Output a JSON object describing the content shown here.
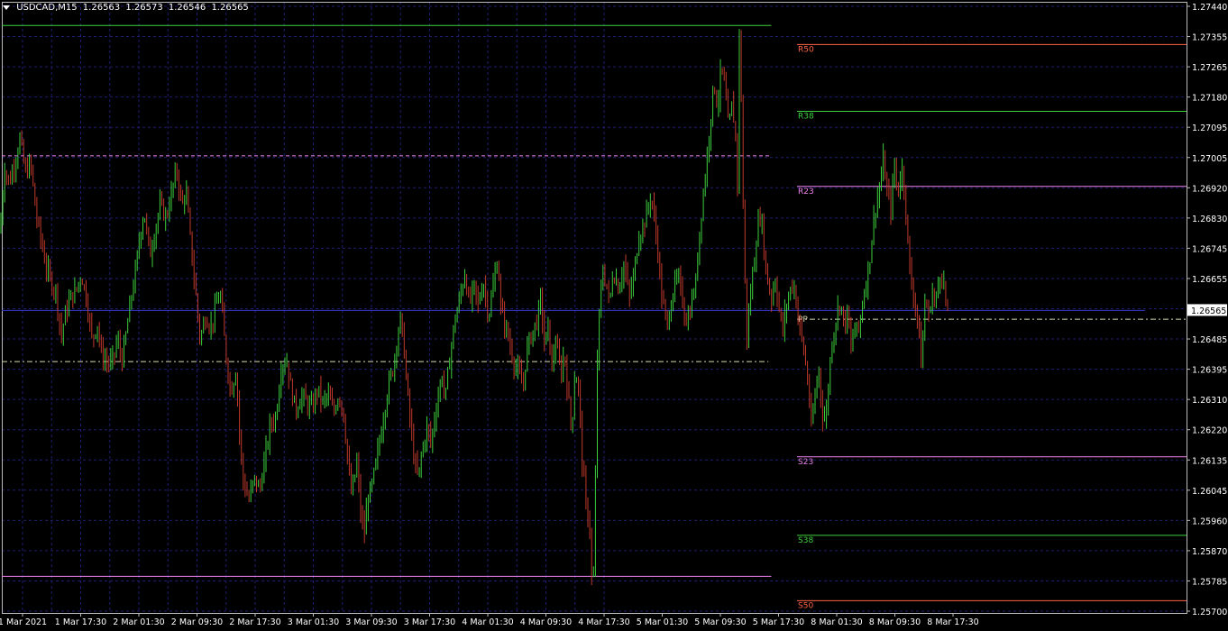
{
  "header": {
    "symbol": "USDCAD,M15",
    "open": "1.26563",
    "high": "1.26573",
    "low": "1.26546",
    "close": "1.26565"
  },
  "colors": {
    "background": "#000000",
    "grid": "#1e1e6e",
    "bull": "#3ccf3c",
    "bear": "#c0392b",
    "axis_text": "#ffffff",
    "pivot": "#d8d8b0",
    "r50": "#ff6347",
    "r38": "#3ccf3c",
    "r23": "#ee82ee",
    "current_price_line": "#3a3ad0",
    "top_line": "#3ccf3c",
    "bottom_line": "#ee82ee",
    "dashed_level": "#ee82ee"
  },
  "chart_data": {
    "type": "candlestick",
    "symbol": "USDCAD",
    "timeframe": "M15",
    "y_ticks": [
      "1.27440",
      "1.27355",
      "1.27265",
      "1.27180",
      "1.27095",
      "1.27005",
      "1.26920",
      "1.26830",
      "1.26745",
      "1.26655",
      "1.26565",
      "1.26485",
      "1.26395",
      "1.26310",
      "1.26220",
      "1.26135",
      "1.26045",
      "1.25960",
      "1.25870",
      "1.25785",
      "1.25700"
    ],
    "ylim": [
      1.257,
      1.2744
    ],
    "current_price": "1.26565",
    "x_ticks": [
      "1 Mar 2021",
      "1 Mar 17:30",
      "2 Mar 01:30",
      "2 Mar 09:30",
      "2 Mar 17:30",
      "3 Mar 01:30",
      "3 Mar 09:30",
      "3 Mar 17:30",
      "4 Mar 01:30",
      "4 Mar 09:30",
      "4 Mar 17:30",
      "5 Mar 01:30",
      "5 Mar 09:30",
      "5 Mar 17:30",
      "8 Mar 01:30",
      "8 Mar 09:30",
      "8 Mar 17:30"
    ],
    "path": [
      [
        0,
        1.2679
      ],
      [
        5,
        1.2698
      ],
      [
        10,
        1.2693
      ],
      [
        18,
        1.2701
      ],
      [
        22,
        1.2706
      ],
      [
        28,
        1.2696
      ],
      [
        34,
        1.2699
      ],
      [
        40,
        1.2684
      ],
      [
        46,
        1.2676
      ],
      [
        52,
        1.2668
      ],
      [
        58,
        1.2664
      ],
      [
        62,
        1.2662
      ],
      [
        68,
        1.2649
      ],
      [
        72,
        1.2655
      ],
      [
        78,
        1.266
      ],
      [
        84,
        1.2662
      ],
      [
        90,
        1.2667
      ],
      [
        96,
        1.266
      ],
      [
        102,
        1.2648
      ],
      [
        108,
        1.2653
      ],
      [
        112,
        1.2644
      ],
      [
        118,
        1.2642
      ],
      [
        124,
        1.2641
      ],
      [
        130,
        1.2648
      ],
      [
        136,
        1.2642
      ],
      [
        140,
        1.265
      ],
      [
        146,
        1.2661
      ],
      [
        150,
        1.2667
      ],
      [
        156,
        1.268
      ],
      [
        160,
        1.2685
      ],
      [
        166,
        1.2672
      ],
      [
        172,
        1.268
      ],
      [
        178,
        1.2687
      ],
      [
        184,
        1.2683
      ],
      [
        190,
        1.269
      ],
      [
        196,
        1.2697
      ],
      [
        202,
        1.2686
      ],
      [
        206,
        1.2692
      ],
      [
        210,
        1.268
      ],
      [
        216,
        1.2664
      ],
      [
        222,
        1.2648
      ],
      [
        228,
        1.2655
      ],
      [
        234,
        1.2652
      ],
      [
        240,
        1.2658
      ],
      [
        244,
        1.2662
      ],
      [
        250,
        1.2645
      ],
      [
        256,
        1.2633
      ],
      [
        262,
        1.264
      ],
      [
        266,
        1.2619
      ],
      [
        270,
        1.2607
      ],
      [
        276,
        1.2602
      ],
      [
        282,
        1.2608
      ],
      [
        288,
        1.2605
      ],
      [
        294,
        1.2614
      ],
      [
        300,
        1.2624
      ],
      [
        306,
        1.2626
      ],
      [
        312,
        1.2641
      ],
      [
        318,
        1.2642
      ],
      [
        322,
        1.2635
      ],
      [
        328,
        1.2628
      ],
      [
        334,
        1.2632
      ],
      [
        340,
        1.263
      ],
      [
        346,
        1.2628
      ],
      [
        352,
        1.2634
      ],
      [
        358,
        1.263
      ],
      [
        364,
        1.2632
      ],
      [
        370,
        1.2627
      ],
      [
        376,
        1.2633
      ],
      [
        382,
        1.2625
      ],
      [
        386,
        1.2612
      ],
      [
        390,
        1.2603
      ],
      [
        396,
        1.2613
      ],
      [
        400,
        1.2598
      ],
      [
        404,
        1.2592
      ],
      [
        408,
        1.2603
      ],
      [
        412,
        1.2605
      ],
      [
        418,
        1.2614
      ],
      [
        424,
        1.2624
      ],
      [
        430,
        1.2634
      ],
      [
        436,
        1.264
      ],
      [
        440,
        1.2648
      ],
      [
        444,
        1.2654
      ],
      [
        448,
        1.2646
      ],
      [
        452,
        1.2632
      ],
      [
        456,
        1.2622
      ],
      [
        460,
        1.2612
      ],
      [
        464,
        1.2608
      ],
      [
        468,
        1.2616
      ],
      [
        474,
        1.2623
      ],
      [
        478,
        1.2618
      ],
      [
        482,
        1.2626
      ],
      [
        486,
        1.2632
      ],
      [
        490,
        1.2638
      ],
      [
        494,
        1.2631
      ],
      [
        498,
        1.2641
      ],
      [
        504,
        1.2653
      ],
      [
        510,
        1.266
      ],
      [
        516,
        1.2668
      ],
      [
        520,
        1.2658
      ],
      [
        526,
        1.2663
      ],
      [
        530,
        1.2658
      ],
      [
        536,
        1.2665
      ],
      [
        542,
        1.2655
      ],
      [
        548,
        1.2665
      ],
      [
        552,
        1.2672
      ],
      [
        556,
        1.2655
      ],
      [
        560,
        1.2653
      ],
      [
        566,
        1.2646
      ],
      [
        572,
        1.264
      ],
      [
        576,
        1.2638
      ],
      [
        580,
        1.2634
      ],
      [
        584,
        1.2645
      ],
      [
        590,
        1.265
      ],
      [
        596,
        1.2654
      ],
      [
        600,
        1.266
      ],
      [
        604,
        1.2646
      ],
      [
        608,
        1.2652
      ],
      [
        612,
        1.264
      ],
      [
        616,
        1.2648
      ],
      [
        622,
        1.2638
      ],
      [
        626,
        1.2645
      ],
      [
        630,
        1.2632
      ],
      [
        634,
        1.2622
      ],
      [
        638,
        1.264
      ],
      [
        642,
        1.2633
      ],
      [
        646,
        1.2612
      ],
      [
        650,
        1.26
      ],
      [
        654,
        1.2595
      ],
      [
        656,
        1.258
      ],
      [
        658,
        1.2576
      ],
      [
        660,
        1.26
      ],
      [
        662,
        1.264
      ],
      [
        664,
        1.2652
      ],
      [
        668,
        1.2668
      ],
      [
        672,
        1.2665
      ],
      [
        676,
        1.2658
      ],
      [
        680,
        1.2668
      ],
      [
        686,
        1.2663
      ],
      [
        692,
        1.267
      ],
      [
        698,
        1.266
      ],
      [
        704,
        1.2668
      ],
      [
        708,
        1.2678
      ],
      [
        714,
        1.2681
      ],
      [
        718,
        1.2685
      ],
      [
        722,
        1.269
      ],
      [
        726,
        1.2682
      ],
      [
        730,
        1.2673
      ],
      [
        734,
        1.266
      ],
      [
        740,
        1.2652
      ],
      [
        746,
        1.2662
      ],
      [
        752,
        1.2666
      ],
      [
        758,
        1.2658
      ],
      [
        762,
        1.2653
      ],
      [
        768,
        1.266
      ],
      [
        772,
        1.2665
      ],
      [
        776,
        1.268
      ],
      [
        780,
        1.269
      ],
      [
        784,
        1.27
      ],
      [
        788,
        1.2712
      ],
      [
        792,
        1.2722
      ],
      [
        796,
        1.2715
      ],
      [
        800,
        1.2727
      ],
      [
        804,
        1.272
      ],
      [
        808,
        1.2708
      ],
      [
        812,
        1.2716
      ],
      [
        816,
        1.2706
      ],
      [
        818,
        1.2693
      ],
      [
        820,
        1.2735
      ],
      [
        822,
        1.272
      ],
      [
        824,
        1.2688
      ],
      [
        826,
        1.2668
      ],
      [
        828,
        1.2648
      ],
      [
        832,
        1.266
      ],
      [
        836,
        1.267
      ],
      [
        840,
        1.268
      ],
      [
        844,
        1.2685
      ],
      [
        848,
        1.2672
      ],
      [
        852,
        1.2664
      ],
      [
        856,
        1.266
      ],
      [
        860,
        1.2666
      ],
      [
        864,
        1.2657
      ],
      [
        868,
        1.265
      ],
      [
        872,
        1.2658
      ],
      [
        876,
        1.2662
      ],
      [
        880,
        1.2665
      ],
      [
        884,
        1.2657
      ],
      [
        888,
        1.265
      ],
      [
        892,
        1.2644
      ],
      [
        896,
        1.2636
      ],
      [
        900,
        1.2622
      ],
      [
        904,
        1.2632
      ],
      [
        908,
        1.264
      ],
      [
        912,
        1.2627
      ],
      [
        916,
        1.2625
      ],
      [
        920,
        1.264
      ],
      [
        924,
        1.265
      ],
      [
        928,
        1.2655
      ],
      [
        932,
        1.266
      ],
      [
        936,
        1.2652
      ],
      [
        940,
        1.2656
      ],
      [
        944,
        1.2645
      ],
      [
        948,
        1.2652
      ],
      [
        952,
        1.265
      ],
      [
        956,
        1.2658
      ],
      [
        960,
        1.2664
      ],
      [
        964,
        1.267
      ],
      [
        968,
        1.268
      ],
      [
        972,
        1.2688
      ],
      [
        976,
        1.2692
      ],
      [
        980,
        1.27
      ],
      [
        984,
        1.269
      ],
      [
        988,
        1.2686
      ],
      [
        992,
        1.2698
      ],
      [
        996,
        1.269
      ],
      [
        1000,
        1.2698
      ],
      [
        1004,
        1.269
      ],
      [
        1008,
        1.267
      ],
      [
        1012,
        1.2662
      ],
      [
        1016,
        1.2658
      ],
      [
        1020,
        1.2648
      ],
      [
        1022,
        1.264
      ],
      [
        1026,
        1.266
      ],
      [
        1030,
        1.2655
      ],
      [
        1034,
        1.2662
      ],
      [
        1038,
        1.2658
      ],
      [
        1042,
        1.2668
      ],
      [
        1046,
        1.2666
      ],
      [
        1050,
        1.2656
      ],
      [
        1052,
        1.2655
      ]
    ],
    "horizontal_lines": [
      {
        "name": "top-line",
        "price": 1.27385,
        "from": 0.0,
        "to": 0.6495,
        "style": "solid",
        "color_key": "top_line"
      },
      {
        "name": "dashed-level",
        "price": 1.2701,
        "from": 0.0,
        "to": 0.6495,
        "style": "dashed",
        "color_key": "dashed_level"
      },
      {
        "name": "pivot-left",
        "price": 1.26418,
        "from": 0.0,
        "to": 0.647,
        "style": "dashdot",
        "color_key": "pivot"
      },
      {
        "name": "bottom-line",
        "price": 1.258,
        "from": 0.0,
        "to": 0.6495,
        "style": "solid",
        "color_key": "bottom_line"
      },
      {
        "name": "current-price-line",
        "price": 1.26565,
        "from": 0.0,
        "to": 0.965,
        "style": "solid",
        "color_key": "current_price_line"
      }
    ],
    "pivot_levels": [
      {
        "label": "R50",
        "price": 1.2733,
        "color_key": "r50"
      },
      {
        "label": "R38",
        "price": 1.27138,
        "color_key": "r38"
      },
      {
        "label": "R23",
        "price": 1.26922,
        "color_key": "r23"
      },
      {
        "label": "PP",
        "price": 1.2654,
        "color_key": "pivot",
        "style": "dashdot"
      },
      {
        "label": "S23",
        "price": 1.26144,
        "color_key": "r23"
      },
      {
        "label": "S38",
        "price": 1.25918,
        "color_key": "r38"
      },
      {
        "label": "S50",
        "price": 1.2573,
        "color_key": "r50"
      }
    ],
    "grid": true
  }
}
